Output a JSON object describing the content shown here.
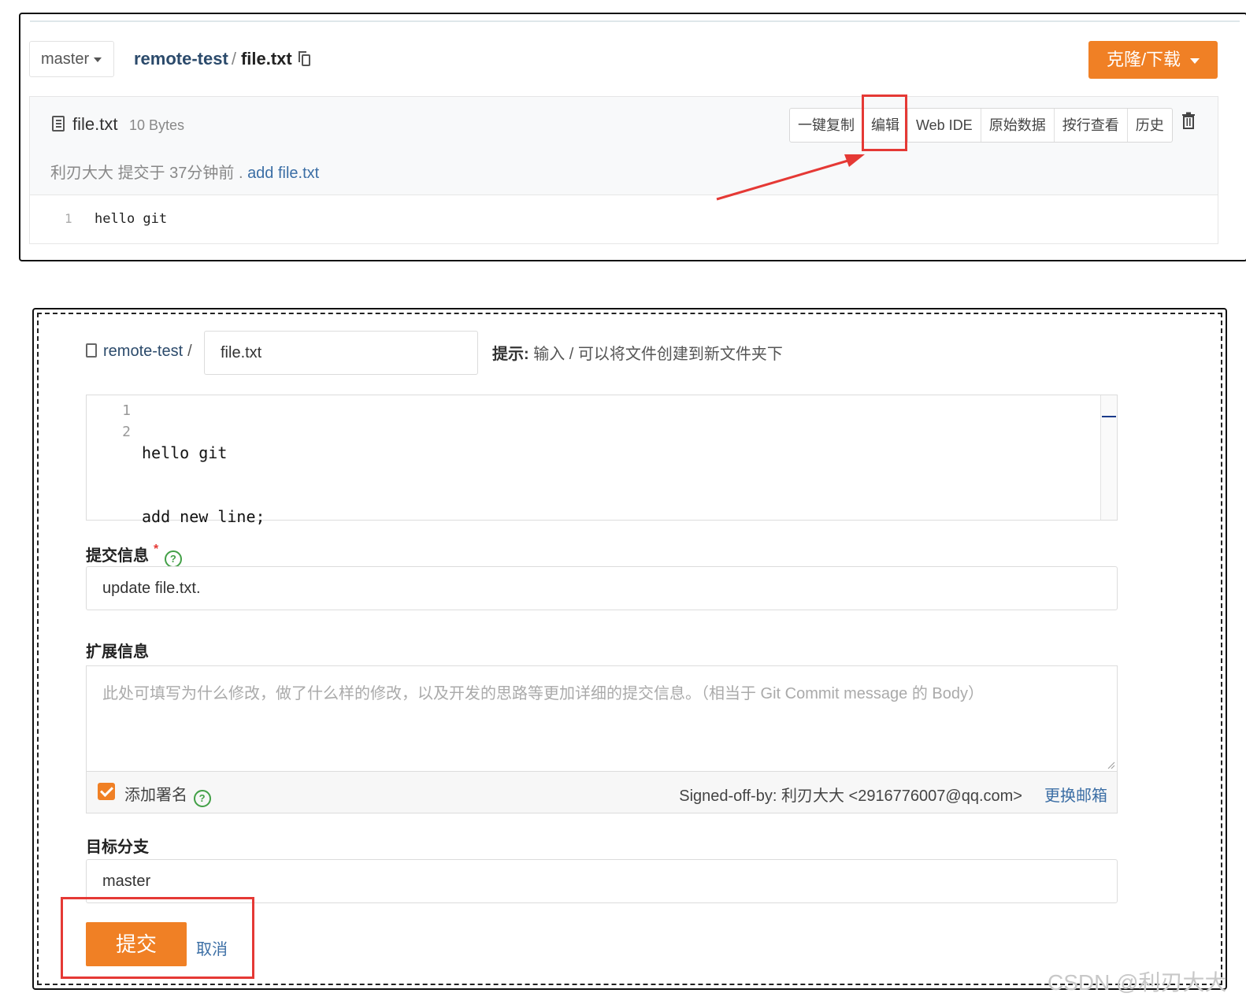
{
  "view_page": {
    "branch": "master",
    "breadcrumb": {
      "repo": "remote-test",
      "separator": "/",
      "file": "file.txt"
    },
    "clone_button": "克隆/下载",
    "file": {
      "name": "file.txt",
      "size": "10 Bytes"
    },
    "commit": {
      "author": "利刃大大",
      "action": "提交于",
      "time": "37分钟前",
      "dot": ".",
      "message": "add file.txt"
    },
    "toolbar": [
      "一键复制",
      "编辑",
      "Web IDE",
      "原始数据",
      "按行查看",
      "历史"
    ],
    "code": {
      "line_number": "1",
      "text": "hello git"
    }
  },
  "edit_page": {
    "breadcrumb_repo": "remote-test",
    "separator": "/",
    "filename_value": "file.txt",
    "hint_label": "提示:",
    "hint_text": "输入 / 可以将文件创建到新文件夹下",
    "editor": {
      "line_numbers": [
        "1",
        "2"
      ],
      "lines": [
        "hello git",
        "add new line;"
      ]
    },
    "commit_label": "提交信息",
    "required_star": "*",
    "help": "?",
    "commit_value": "update file.txt.",
    "extended_label": "扩展信息",
    "extended_placeholder": "此处可填写为什么修改，做了什么样的修改，以及开发的思路等更加详细的提交信息。（相当于 Git Commit message 的 Body）",
    "signoff_label": "添加署名",
    "signoff_checked": true,
    "signoff_text": "Signed-off-by: 利刃大大 <2916776007@qq.com>",
    "change_email": "更换邮箱",
    "target_branch_label": "目标分支",
    "target_branch_value": "master",
    "submit_label": "提交",
    "cancel_label": "取消"
  },
  "colors": {
    "accent": "#f08025",
    "link": "#3b6ea5",
    "highlight": "#e53935",
    "help": "#43a047"
  },
  "watermark": "CSDN @利刃大大"
}
